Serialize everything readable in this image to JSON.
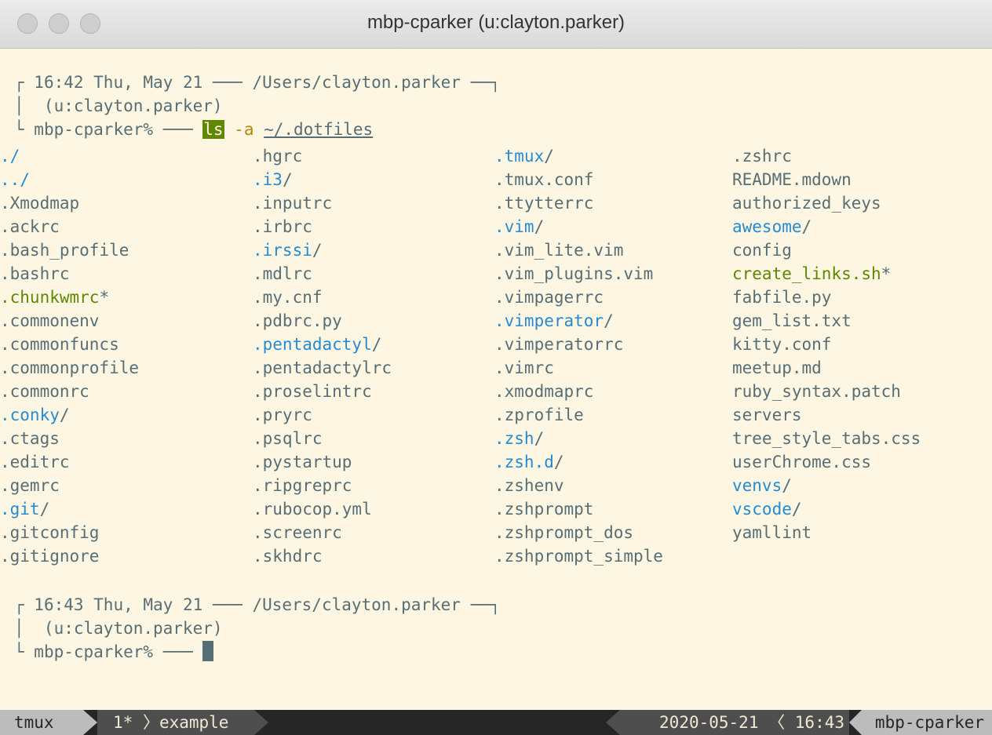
{
  "window": {
    "title": "mbp-cparker (u:clayton.parker)"
  },
  "prompt1": {
    "corner_top": "┌",
    "header": " 16:42 Thu, May 21 ─── /Users/clayton.parker ──┐",
    "user": "│  (u:clayton.parker)",
    "corner_bottom": "└",
    "host": " mbp-cparker% ─── ",
    "cmd": "ls",
    "opt": " -a ",
    "arg": "~/.dotfiles"
  },
  "listing": {
    "col1": [
      {
        "name": "./",
        "type": "dir"
      },
      {
        "name": "../",
        "type": "dir"
      },
      {
        "name": ".Xmodmap",
        "type": "file"
      },
      {
        "name": ".ackrc",
        "type": "file"
      },
      {
        "name": ".bash_profile",
        "type": "file"
      },
      {
        "name": ".bashrc",
        "type": "file"
      },
      {
        "name": ".chunkwmrc",
        "type": "exec",
        "suffix": "*"
      },
      {
        "name": ".commonenv",
        "type": "file"
      },
      {
        "name": ".commonfuncs",
        "type": "file"
      },
      {
        "name": ".commonprofile",
        "type": "file"
      },
      {
        "name": ".commonrc",
        "type": "file"
      },
      {
        "name": ".conky",
        "type": "dir",
        "suffix": "/"
      },
      {
        "name": ".ctags",
        "type": "file"
      },
      {
        "name": ".editrc",
        "type": "file"
      },
      {
        "name": ".gemrc",
        "type": "file"
      },
      {
        "name": ".git",
        "type": "dir",
        "suffix": "/"
      },
      {
        "name": ".gitconfig",
        "type": "file"
      },
      {
        "name": ".gitignore",
        "type": "file"
      }
    ],
    "col2": [
      {
        "name": ".hgrc",
        "type": "file"
      },
      {
        "name": ".i3",
        "type": "dir",
        "suffix": "/"
      },
      {
        "name": ".inputrc",
        "type": "file"
      },
      {
        "name": ".irbrc",
        "type": "file"
      },
      {
        "name": ".irssi",
        "type": "dir",
        "suffix": "/"
      },
      {
        "name": ".mdlrc",
        "type": "file"
      },
      {
        "name": ".my.cnf",
        "type": "file"
      },
      {
        "name": ".pdbrc.py",
        "type": "file"
      },
      {
        "name": ".pentadactyl",
        "type": "dir",
        "suffix": "/"
      },
      {
        "name": ".pentadactylrc",
        "type": "file"
      },
      {
        "name": ".proselintrc",
        "type": "file"
      },
      {
        "name": ".pryrc",
        "type": "file"
      },
      {
        "name": ".psqlrc",
        "type": "file"
      },
      {
        "name": ".pystartup",
        "type": "file"
      },
      {
        "name": ".ripgreprc",
        "type": "file"
      },
      {
        "name": ".rubocop.yml",
        "type": "file"
      },
      {
        "name": ".screenrc",
        "type": "file"
      },
      {
        "name": ".skhdrc",
        "type": "file"
      }
    ],
    "col3": [
      {
        "name": ".tmux",
        "type": "dir",
        "suffix": "/"
      },
      {
        "name": ".tmux.conf",
        "type": "file"
      },
      {
        "name": ".ttytterrc",
        "type": "file"
      },
      {
        "name": ".vim",
        "type": "dir",
        "suffix": "/"
      },
      {
        "name": ".vim_lite.vim",
        "type": "file"
      },
      {
        "name": ".vim_plugins.vim",
        "type": "file"
      },
      {
        "name": ".vimpagerrc",
        "type": "file"
      },
      {
        "name": ".vimperator",
        "type": "dir",
        "suffix": "/"
      },
      {
        "name": ".vimperatorrc",
        "type": "file"
      },
      {
        "name": ".vimrc",
        "type": "file"
      },
      {
        "name": ".xmodmaprc",
        "type": "file"
      },
      {
        "name": ".zprofile",
        "type": "file"
      },
      {
        "name": ".zsh",
        "type": "dir",
        "suffix": "/"
      },
      {
        "name": ".zsh.d",
        "type": "dir",
        "suffix": "/"
      },
      {
        "name": ".zshenv",
        "type": "file"
      },
      {
        "name": ".zshprompt",
        "type": "file"
      },
      {
        "name": ".zshprompt_dos",
        "type": "file"
      },
      {
        "name": ".zshprompt_simple",
        "type": "file"
      }
    ],
    "col4": [
      {
        "name": ".zshrc",
        "type": "file"
      },
      {
        "name": "README.mdown",
        "type": "file"
      },
      {
        "name": "authorized_keys",
        "type": "file"
      },
      {
        "name": "awesome",
        "type": "dir",
        "suffix": "/"
      },
      {
        "name": "config",
        "type": "file"
      },
      {
        "name": "create_links.sh",
        "type": "exec",
        "suffix": "*"
      },
      {
        "name": "fabfile.py",
        "type": "file"
      },
      {
        "name": "gem_list.txt",
        "type": "file"
      },
      {
        "name": "kitty.conf",
        "type": "file"
      },
      {
        "name": "meetup.md",
        "type": "file"
      },
      {
        "name": "ruby_syntax.patch",
        "type": "file"
      },
      {
        "name": "servers",
        "type": "file"
      },
      {
        "name": "tree_style_tabs.css",
        "type": "file"
      },
      {
        "name": "userChrome.css",
        "type": "file"
      },
      {
        "name": "venvs",
        "type": "dir",
        "suffix": "/"
      },
      {
        "name": "vscode",
        "type": "dir",
        "suffix": "/"
      },
      {
        "name": "yamllint",
        "type": "file"
      }
    ]
  },
  "prompt2": {
    "corner_top": "┌",
    "header": " 16:43 Thu, May 21 ─── /Users/clayton.parker ──┐",
    "user": "│  (u:clayton.parker)",
    "corner_bottom": "└",
    "host": " mbp-cparker% ─── "
  },
  "status": {
    "session": "tmux",
    "window_index": "1*",
    "separator": "〉",
    "window_name": "example",
    "date": "2020-05-21",
    "time_sep": "〈",
    "time": "16:43",
    "hostname": "mbp-cparker"
  },
  "colors": {
    "background": "#fdf6e3",
    "text": "#586e75",
    "directory": "#268bd2",
    "executable": "#5f8700",
    "option": "#b58900",
    "statusbar": "#262626"
  }
}
